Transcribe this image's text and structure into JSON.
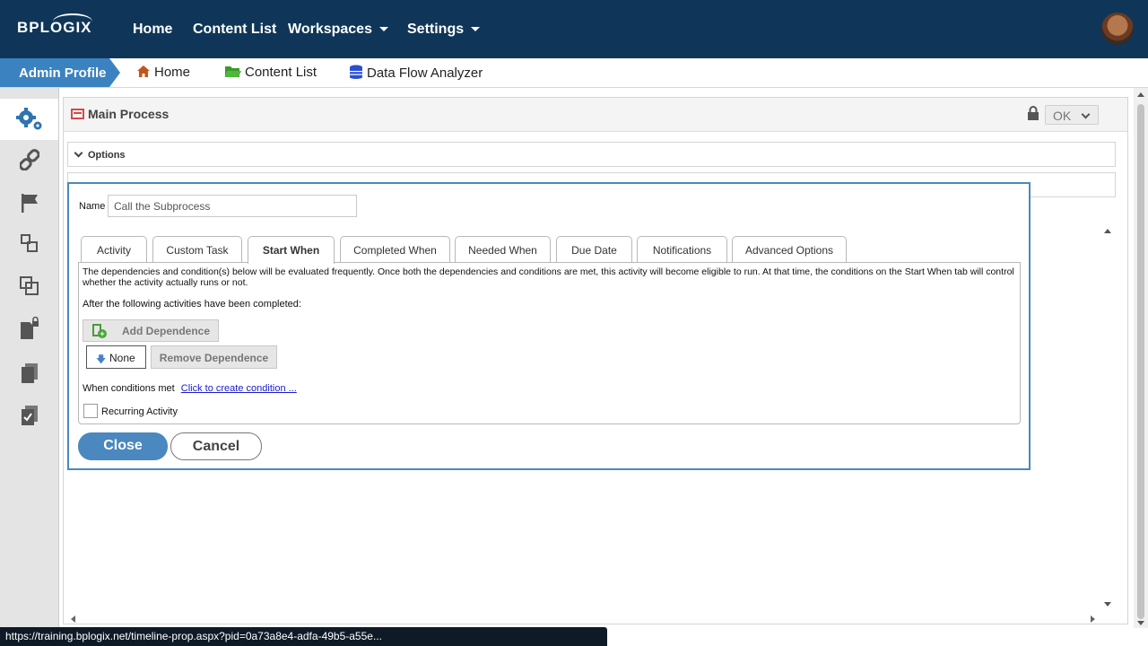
{
  "topbar": {
    "logo": "BPLOGIX",
    "nav": [
      {
        "label": "Home"
      },
      {
        "label": "Content List"
      },
      {
        "label": "Workspaces"
      },
      {
        "label": "Settings"
      }
    ]
  },
  "subbar": {
    "profile": "Admin Profile",
    "links": [
      {
        "label": "Home"
      },
      {
        "label": "Content List"
      },
      {
        "label": "Data Flow Analyzer"
      }
    ]
  },
  "panel": {
    "title": "Main Process",
    "ok_label": "OK",
    "options_label": "Options"
  },
  "dialog": {
    "name_label": "Name",
    "name_value": "Call the Subprocess",
    "tabs": [
      {
        "label": "Activity"
      },
      {
        "label": "Custom Task"
      },
      {
        "label": "Start When"
      },
      {
        "label": "Completed When"
      },
      {
        "label": "Needed When"
      },
      {
        "label": "Due Date"
      },
      {
        "label": "Notifications"
      },
      {
        "label": "Advanced Options"
      }
    ],
    "active_tab": "Start When",
    "description": "The dependencies and condition(s) below will be evaluated frequently. Once both the dependencies and conditions are met, this activity will become eligible to run. At that time, the conditions on the Start When tab will control whether the activity actually runs or not.",
    "after_text": "After the following activities have been completed:",
    "add_dependence": "Add Dependence",
    "dependence_value": "None",
    "remove_dependence": "Remove Dependence",
    "conditions_label": "When conditions met",
    "conditions_link": "Click to create condition ...",
    "recurring_label": "Recurring Activity",
    "close_label": "Close",
    "cancel_label": "Cancel"
  },
  "status_url": "https://training.bplogix.net/timeline-prop.aspx?pid=0a73a8e4-adfa-49b5-a55e...",
  "colors": {
    "topbar": "#0f3658",
    "accent": "#4a88bf",
    "link": "#1a1ad0"
  }
}
